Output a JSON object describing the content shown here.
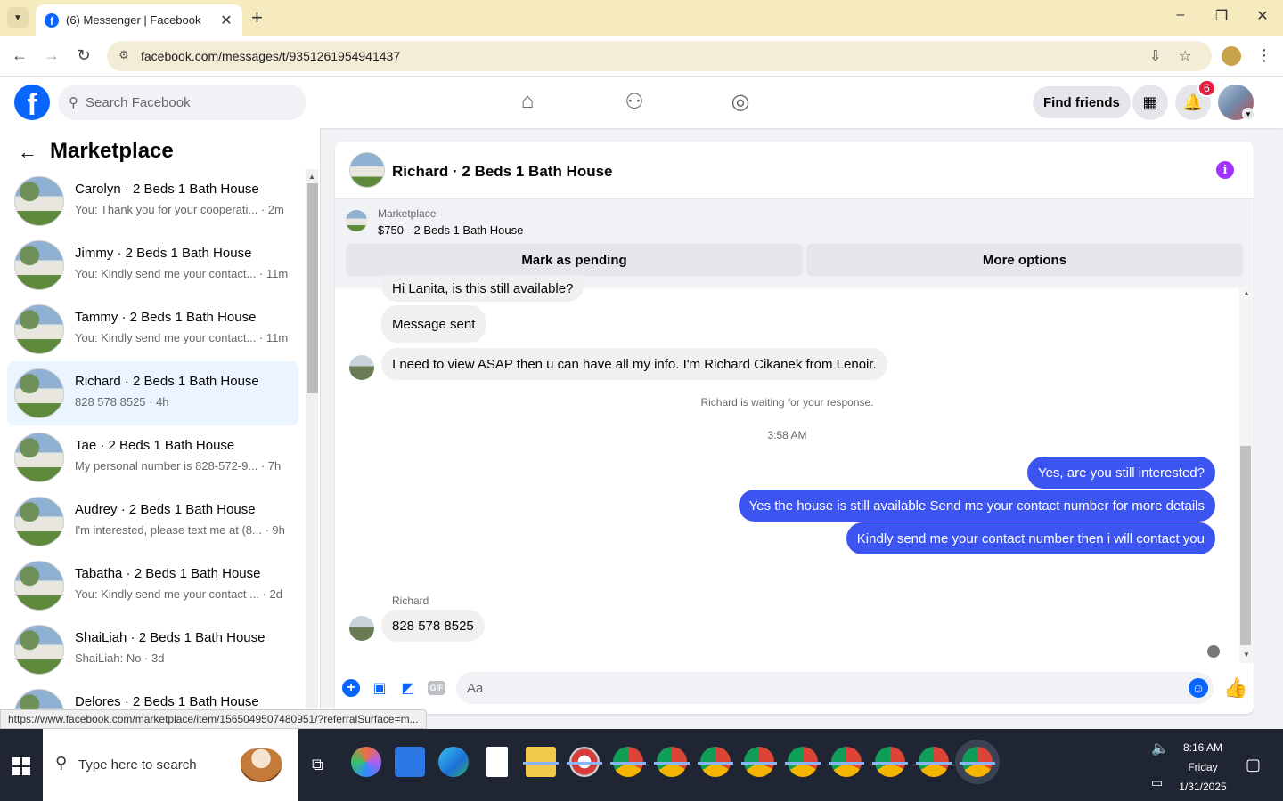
{
  "browser": {
    "tab_title": "(6) Messenger | Facebook",
    "url": "facebook.com/messages/t/9351261954941437",
    "minimize": "–",
    "maximize": "❐",
    "close": "✕",
    "new_tab": "+"
  },
  "fb": {
    "search_placeholder": "Search Facebook",
    "find_friends": "Find friends",
    "notification_count": "6",
    "logo_letter": "f"
  },
  "sidebar": {
    "title": "Marketplace",
    "conversations": [
      {
        "name": "Carolyn · 2 Beds 1 Bath House",
        "preview": "You: Thank you for your cooperati... · 2m"
      },
      {
        "name": "Jimmy · 2 Beds 1 Bath House",
        "preview": "You: Kindly send me your contact... · 11m"
      },
      {
        "name": "Tammy · 2 Beds 1 Bath House",
        "preview": "You: Kindly send me your contact... · 11m"
      },
      {
        "name": "Richard · 2 Beds 1 Bath House",
        "preview": "828 578 8525 · 4h"
      },
      {
        "name": "Tae · 2 Beds 1 Bath House",
        "preview": "My personal number is 828-572-9... · 7h"
      },
      {
        "name": "Audrey · 2 Beds 1 Bath House",
        "preview": "I'm interested, please text me at (8... · 9h"
      },
      {
        "name": "Tabatha · 2 Beds 1 Bath House",
        "preview": "You: Kindly send me your contact ... · 2d"
      },
      {
        "name": "ShaiLiah · 2 Beds 1 Bath House",
        "preview": "ShaiLiah: No · 3d"
      },
      {
        "name": "Delores · 2 Beds 1 Bath House",
        "preview": ""
      }
    ]
  },
  "chat": {
    "title": "Richard · 2 Beds 1 Bath House",
    "marketplace_label": "Marketplace",
    "listing": "$750 - 2 Beds 1 Bath House",
    "mark_pending": "Mark as pending",
    "more_options": "More options",
    "messages": {
      "m1": "Hi Lanita, is this still available?",
      "m2": "Message sent",
      "m3": "I need to view ASAP then u can have  all my info. I'm Richard  Cikanek from Lenoir.",
      "waiting": "Richard is waiting for your response.",
      "time": "3:58 AM",
      "o1": "Yes, are you still interested?",
      "o2": "Yes the house is still available Send me your contact number for more details",
      "o3": "Kindly send me your contact number then i will contact you",
      "sender": "Richard",
      "m4": "828 578 8525"
    },
    "composer_placeholder": "Aa",
    "gif_label": "GIF"
  },
  "status_url": "https://www.facebook.com/marketplace/item/1565049507480951/?referralSurface=m...",
  "taskbar": {
    "search_placeholder": "Type here to search",
    "time": "8:16 AM",
    "day": "Friday",
    "date": "1/31/2025"
  }
}
